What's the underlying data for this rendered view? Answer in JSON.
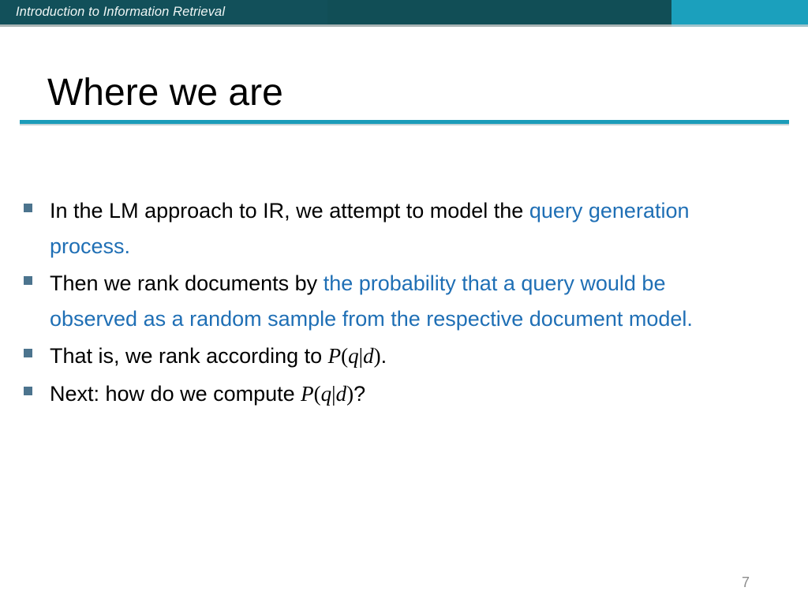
{
  "header": {
    "title": "Introduction to Information Retrieval",
    "dark_color": "#114e56",
    "accent_color": "#1ba0bd"
  },
  "slide": {
    "title": "Where we are",
    "rule_color": "#1b9cb9",
    "page_number": "7",
    "bullet_marker_color": "#4c748e",
    "highlight_color": "#1f6fb5",
    "bullets": [
      {
        "id": "bullet-lm-approach",
        "fragments": [
          {
            "text": "In the LM approach to IR, we attempt to model the ",
            "style": "black"
          },
          {
            "text": "query generation process.",
            "style": "blue"
          }
        ],
        "plain": "In the LM approach to IR, we attempt to model the query generation process."
      },
      {
        "id": "bullet-rank-documents",
        "fragments": [
          {
            "text": "Then we rank documents by ",
            "style": "black"
          },
          {
            "text": "the probability that a query would be observed as a random sample from the respective document model.",
            "style": "blue"
          }
        ],
        "plain": "Then we rank documents by the probability that a query would be observed as a random sample from the respective document model."
      },
      {
        "id": "bullet-rank-according",
        "fragments": [
          {
            "text": "That is, we rank according to ",
            "style": "black"
          },
          {
            "text": "P(q|d)",
            "style": "math"
          },
          {
            "text": ".",
            "style": "black"
          }
        ],
        "plain": "That is, we rank according to P(q|d)."
      },
      {
        "id": "bullet-next-compute",
        "fragments": [
          {
            "text": "Next: how do we compute ",
            "style": "black"
          },
          {
            "text": "P(q|d)",
            "style": "math"
          },
          {
            "text": "?",
            "style": "black"
          }
        ],
        "plain": "Next: how do we compute P(q|d)?"
      }
    ]
  }
}
